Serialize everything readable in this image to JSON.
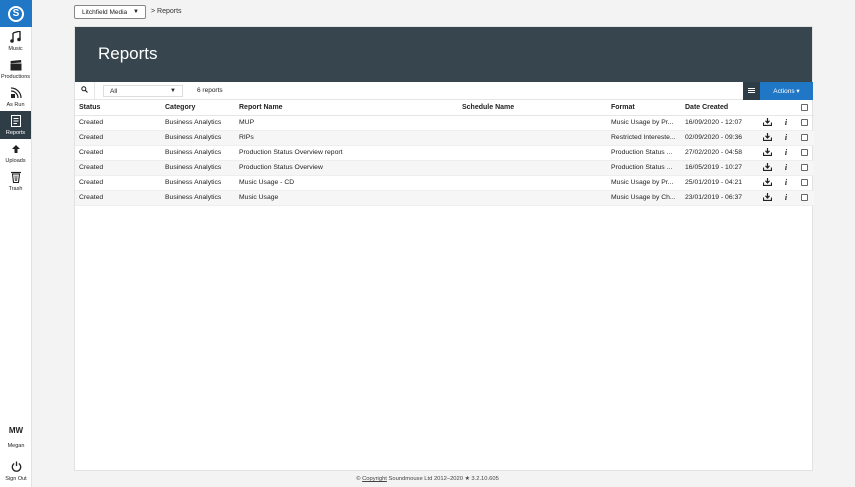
{
  "sidebar": {
    "logo_icon": "soundmouse-logo",
    "items": [
      {
        "label": "Music",
        "icon": "music-note-icon"
      },
      {
        "label": "Productions",
        "icon": "clapperboard-icon"
      },
      {
        "label": "As Run",
        "icon": "broadcast-icon"
      },
      {
        "label": "Reports",
        "icon": "report-icon",
        "active": true
      },
      {
        "label": "Uploads",
        "icon": "upload-icon"
      },
      {
        "label": "Trash",
        "icon": "trash-icon"
      }
    ],
    "user_initials": "MW",
    "user_name": "Megan",
    "signout_label": "Sign Out"
  },
  "topbar": {
    "org_select": "Litchfield Media",
    "breadcrumb": "> Reports"
  },
  "banner": {
    "title": "Reports"
  },
  "toolbar": {
    "filter_value": "All",
    "count_text": "6 reports",
    "actions_label": "Actions ▾"
  },
  "table": {
    "columns": {
      "status": "Status",
      "category": "Category",
      "name": "Report Name",
      "schedule": "Schedule Name",
      "format": "Format",
      "date": "Date Created"
    },
    "rows": [
      {
        "status": "Created",
        "category": "Business Analytics",
        "name": "MUP",
        "schedule": "",
        "format": "Music Usage by Pr...",
        "date": "16/09/2020 - 12:07"
      },
      {
        "status": "Created",
        "category": "Business Analytics",
        "name": "RIPs",
        "schedule": "",
        "format": "Restricted Intereste...",
        "date": "02/09/2020 - 09:36"
      },
      {
        "status": "Created",
        "category": "Business Analytics",
        "name": "Production Status Overview report",
        "schedule": "",
        "format": "Production Status ...",
        "date": "27/02/2020 - 04:58"
      },
      {
        "status": "Created",
        "category": "Business Analytics",
        "name": "Production Status Overview",
        "schedule": "",
        "format": "Production Status ...",
        "date": "16/05/2019 - 10:27"
      },
      {
        "status": "Created",
        "category": "Business Analytics",
        "name": "Music Usage - CD",
        "schedule": "",
        "format": "Music Usage by Pr...",
        "date": "25/01/2019 - 04:21"
      },
      {
        "status": "Created",
        "category": "Business Analytics",
        "name": "Music Usage",
        "schedule": "",
        "format": "Music Usage by Ch...",
        "date": "23/01/2019 - 06:37"
      }
    ]
  },
  "footer": {
    "prefix": "© ",
    "link": "Copyright",
    "suffix": " Soundmouse Ltd 2012–2020 ★ 3.2.10.605"
  },
  "colors": {
    "accent": "#1f77c5",
    "banner": "#37454e",
    "dark": "#2f3d47"
  }
}
